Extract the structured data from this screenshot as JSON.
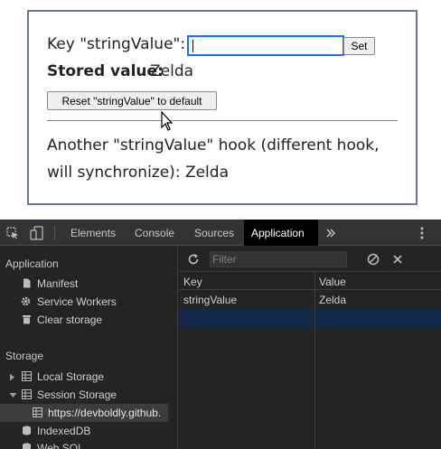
{
  "demo": {
    "key_label": "Key \"stringValue\":",
    "key_input_value": "",
    "set_button": "Set",
    "stored_label": "Stored value:",
    "stored_value": "Zelda",
    "reset_button": "Reset \"stringValue\" to default",
    "another_line1": "Another \"stringValue\" hook (different hook,",
    "another_line2": "will synchronize): Zelda"
  },
  "devtools": {
    "tabs": [
      "Elements",
      "Console",
      "Sources",
      "Application"
    ],
    "active_tab": "Application",
    "more_tabs_icon": "chevron-double-right-icon",
    "menu_icon": "kebab-menu-icon",
    "sidebar": {
      "application_heading": "Application",
      "application_items": [
        "Manifest",
        "Service Workers",
        "Clear storage"
      ],
      "storage_heading": "Storage",
      "storage_items": [
        "Local Storage",
        "Session Storage",
        "https://devboldly.github.",
        "IndexedDB",
        "Web SQL"
      ]
    },
    "filter_placeholder": "Filter",
    "table": {
      "columns": [
        "Key",
        "Value"
      ],
      "rows": [
        {
          "key": "stringValue",
          "value": "Zelda"
        }
      ]
    },
    "colors": {
      "active_tab_bg": "#000000",
      "selected_row_bg": "#0f2b47",
      "panel_bg": "#242424"
    }
  }
}
